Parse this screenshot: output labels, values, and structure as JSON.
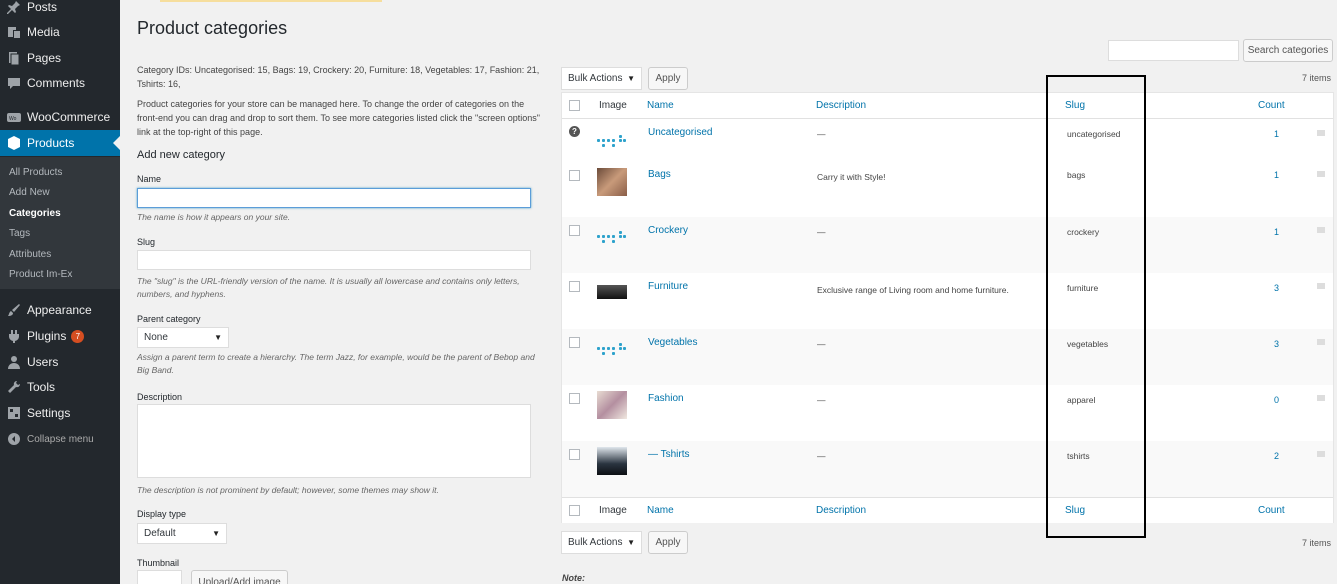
{
  "sidebar": {
    "items": [
      {
        "label": "Posts",
        "icon": "pin-icon"
      },
      {
        "label": "Media",
        "icon": "media-icon"
      },
      {
        "label": "Pages",
        "icon": "pages-icon"
      },
      {
        "label": "Comments",
        "icon": "comments-icon"
      },
      {
        "label": "WooCommerce",
        "icon": "woocommerce-icon"
      },
      {
        "label": "Products",
        "icon": "products-icon"
      },
      {
        "label": "Appearance",
        "icon": "appearance-icon"
      },
      {
        "label": "Plugins",
        "icon": "plugins-icon",
        "badge": "7"
      },
      {
        "label": "Users",
        "icon": "users-icon"
      },
      {
        "label": "Tools",
        "icon": "tools-icon"
      },
      {
        "label": "Settings",
        "icon": "settings-icon"
      },
      {
        "label": "Collapse menu",
        "icon": "collapse-icon"
      }
    ],
    "submenu": [
      "All Products",
      "Add New",
      "Categories",
      "Tags",
      "Attributes",
      "Product Im-Ex"
    ]
  },
  "page": {
    "title": "Product categories",
    "ids_text": "Category IDs: Uncategorised: 15, Bags: 19, Crockery: 20, Furniture: 18, Vegetables: 17, Fashion: 21, Tshirts: 16,",
    "intro": "Product categories for your store can be managed here. To change the order of categories on the front-end you can drag and drop to sort them. To see more categories listed click the \"screen options\" link at the top-right of this page."
  },
  "form": {
    "heading": "Add new category",
    "name_label": "Name",
    "name_value": "",
    "name_hint": "The name is how it appears on your site.",
    "slug_label": "Slug",
    "slug_value": "",
    "slug_hint": "The \"slug\" is the URL-friendly version of the name. It is usually all lowercase and contains only letters, numbers, and hyphens.",
    "parent_label": "Parent category",
    "parent_value": "None",
    "parent_hint": "Assign a parent term to create a hierarchy. The term Jazz, for example, would be the parent of Bebop and Big Band.",
    "desc_label": "Description",
    "desc_value": "",
    "desc_hint": "The description is not prominent by default; however, some themes may show it.",
    "display_label": "Display type",
    "display_value": "Default",
    "thumb_label": "Thumbnail",
    "upload_label": "Upload/Add image"
  },
  "toolbar": {
    "search_placeholder": "",
    "search_button": "Search categories",
    "bulk_actions": "Bulk Actions",
    "apply": "Apply",
    "items_count": "7 items"
  },
  "table": {
    "columns": {
      "image": "Image",
      "name": "Name",
      "description": "Description",
      "slug": "Slug",
      "count": "Count"
    },
    "rows": [
      {
        "name": "Uncategorised",
        "description": "—",
        "slug": "uncategorised",
        "count": "1",
        "thumb": "placeholder"
      },
      {
        "name": "Bags",
        "description": "Carry it with Style!",
        "slug": "bags",
        "count": "1",
        "thumb": "bag"
      },
      {
        "name": "Crockery",
        "description": "—",
        "slug": "crockery",
        "count": "1",
        "thumb": "placeholder"
      },
      {
        "name": "Furniture",
        "description": "Exclusive range of Living room and home furniture.",
        "slug": "furniture",
        "count": "3",
        "thumb": "sofa"
      },
      {
        "name": "Vegetables",
        "description": "—",
        "slug": "vegetables",
        "count": "3",
        "thumb": "placeholder"
      },
      {
        "name": "Fashion",
        "description": "—",
        "slug": "apparel",
        "count": "0",
        "thumb": "person"
      },
      {
        "name": "— Tshirts",
        "description": "—",
        "slug": "tshirts",
        "count": "2",
        "thumb": "person-dark"
      }
    ]
  },
  "note": "Note:",
  "colors": {
    "sidebar": "#23282d",
    "active": "#0073aa",
    "link": "#0073aa",
    "highlight_border": "#000000"
  }
}
